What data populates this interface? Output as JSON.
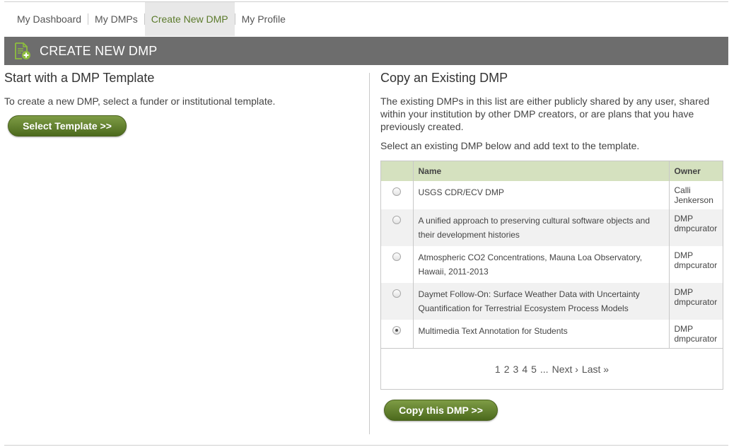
{
  "nav": {
    "items": [
      {
        "label": "My Dashboard"
      },
      {
        "label": "My DMPs"
      },
      {
        "label": "Create New DMP"
      },
      {
        "label": "My Profile"
      }
    ]
  },
  "header": {
    "title": "CREATE NEW DMP",
    "icon": "add-document-icon",
    "accent": "#8dbd3f"
  },
  "template_section": {
    "heading": "Start with a DMP Template",
    "description": "To create a new DMP, select a funder or institutional template.",
    "button_label": "Select Template >>"
  },
  "copy_section": {
    "heading": "Copy an Existing DMP",
    "description": "The existing DMPs in this list are either publicly shared by any user, shared within your institution by other DMP creators, or are plans that you have previously created.",
    "instruction": "Select an existing DMP below and add text to the template.",
    "table": {
      "columns": [
        "Name",
        "Owner"
      ],
      "rows": [
        {
          "name": "USGS CDR/ECV DMP",
          "owner_line1": "Calli",
          "owner_line2": "Jenkerson",
          "selected": false
        },
        {
          "name": "A unified approach to preserving cultural software objects and their development histories",
          "owner_line1": "DMP",
          "owner_line2": "dmpcurator",
          "selected": false
        },
        {
          "name": "Atmospheric CO2 Concentrations, Mauna Loa Observatory, Hawaii, 2011-2013",
          "owner_line1": "DMP",
          "owner_line2": "dmpcurator",
          "selected": false
        },
        {
          "name": "Daymet Follow-On: Surface Weather Data with Uncertainty Quantification for Terrestrial Ecosystem Process Models",
          "owner_line1": "DMP",
          "owner_line2": "dmpcurator",
          "selected": false
        },
        {
          "name": "Multimedia Text Annotation for Students",
          "owner_line1": "DMP",
          "owner_line2": "dmpcurator",
          "selected": true
        }
      ]
    },
    "pager": {
      "pages": [
        "1",
        "2",
        "3",
        "4",
        "5"
      ],
      "ellipsis": "...",
      "next": "Next ›",
      "last": "Last »"
    },
    "button_label": "Copy this DMP >>"
  },
  "colors": {
    "header_bg": "#6d6d6d",
    "button_green": "#5d7b2a",
    "table_header_bg": "#d5e1bf",
    "active_nav_text": "#5b7a2b"
  }
}
